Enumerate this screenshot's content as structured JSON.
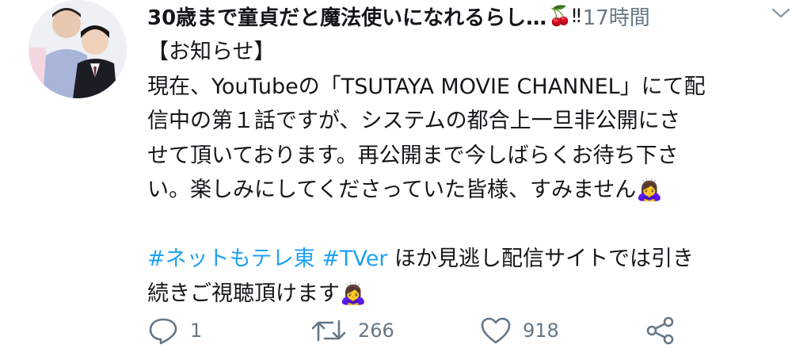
{
  "tweet": {
    "display_name": "30歳まで童貞だと魔法使いになれるらし…",
    "name_emoji": "🍒‼",
    "time": "17時間",
    "body_lines": [
      "【お知らせ】",
      "現在、YouTubeの「TSUTAYA MOVIE CHANNEL」にて配",
      "信中の第１話ですが、システムの都合上一旦非公開にさ",
      "せて頂いております。再公開まで今しばらくお待ち下さ",
      "い。楽しみにしてくださっていた皆様、すみません🙇‍♀️"
    ],
    "hashtag_1": "#ネットもテレ東",
    "hashtag_2": "#TVer",
    "line2_rest": " ほか見逃し配信サイトでは引き",
    "line3": "続きご視聴頂けます🙇‍♀️"
  },
  "actions": {
    "reply_count": "1",
    "retweet_count": "266",
    "like_count": "918"
  },
  "icons": {
    "reply": "reply-icon",
    "retweet": "retweet-icon",
    "like": "heart-icon",
    "share": "share-icon",
    "menu": "chevron-down-icon"
  },
  "colors": {
    "text": "#14171a",
    "secondary": "#657786",
    "hashtag": "#1da1f2"
  }
}
